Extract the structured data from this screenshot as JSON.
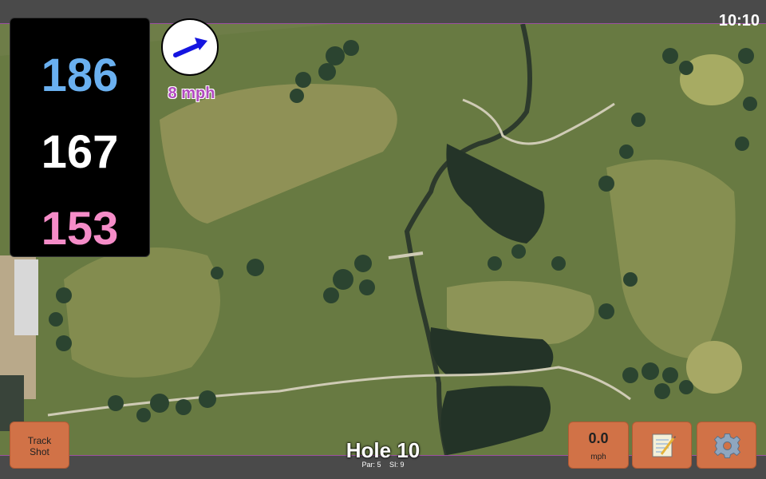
{
  "clock": "10:10",
  "distances": {
    "back": "186",
    "center": "167",
    "front": "153"
  },
  "wind": {
    "speed_text": "8 mph"
  },
  "buttons": {
    "track_shot_line1": "Track",
    "track_shot_line2": "Shot",
    "speed_value": "0.0",
    "speed_unit": "mph"
  },
  "hole": {
    "title": "Hole 10",
    "par_text": "Par: 5",
    "si_text": "SI: 9"
  },
  "icons": {
    "wind_arrow": "wind-direction-arrow-icon",
    "notes": "notepad-icon",
    "settings": "gear-icon"
  },
  "colors": {
    "back": "#6ab0f0",
    "center": "#ffffff",
    "front": "#f58cc8",
    "button": "#d17247",
    "accent": "#9a4fa0"
  }
}
